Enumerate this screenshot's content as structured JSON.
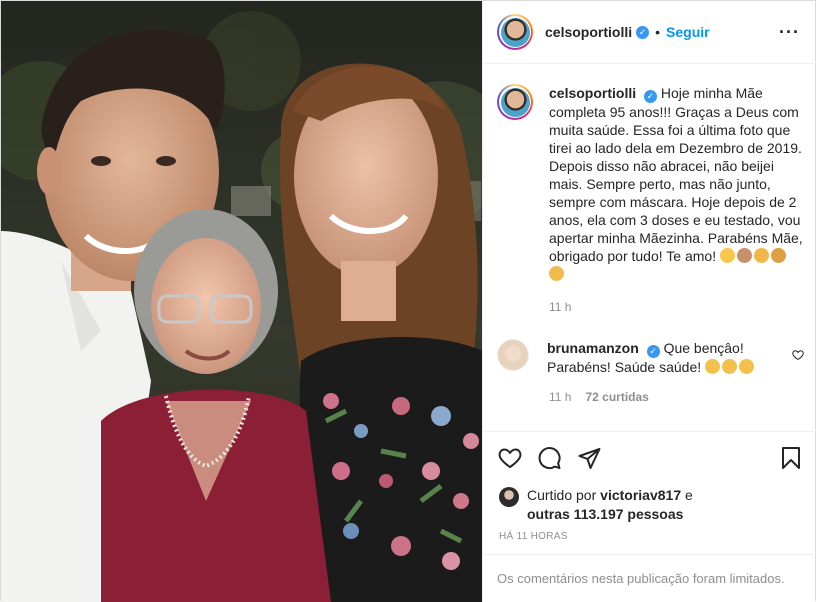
{
  "post": {
    "username": "celsoportiolli",
    "follow_label": "Seguir",
    "more_icon": "more-horizontal-icon",
    "caption": {
      "username": "celsoportiolli",
      "text": "Hoje minha Mãe completa 95 anos!!! Graças a Deus com muita saúde. Essa foi a última foto que tirei ao lado dela em Dezembro de 2019. Depois disso não abracei, não beijei mais. Sempre perto, mas não junto, sempre com máscara. Hoje depois de 2 anos, ela com 3 doses e eu testado, vou apertar minha Mãezinha. Parabéns Mãe, obrigado por tudo! Te amo!",
      "emojis": [
        "smiling-face-with-hearts",
        "birthday-cake",
        "clapping-hands",
        "party-popper",
        "folded-hands"
      ],
      "time": "11 h"
    },
    "comment": {
      "username": "brunamanzon",
      "text": "Que bençâo! Parabéns! Saúde saúde!",
      "emojis": [
        "raising-hands",
        "raising-hands",
        "raising-hands"
      ],
      "time": "11 h",
      "likes": "72 curtidas"
    },
    "likes_line": {
      "prefix": "Curtido por",
      "user": "victoriav817",
      "connector": "e",
      "others": "outras 113.197 pessoas"
    },
    "time_ago": "HÁ 11 HORAS",
    "comments_limited": "Os comentários nesta publicação foram limitados."
  },
  "icons": [
    "heart-icon",
    "comment-icon",
    "share-icon",
    "bookmark-icon"
  ],
  "colors": {
    "link_blue": "#0095f6",
    "verified_blue": "#3897f0",
    "muted": "#8e8e8e",
    "text": "#262626"
  }
}
